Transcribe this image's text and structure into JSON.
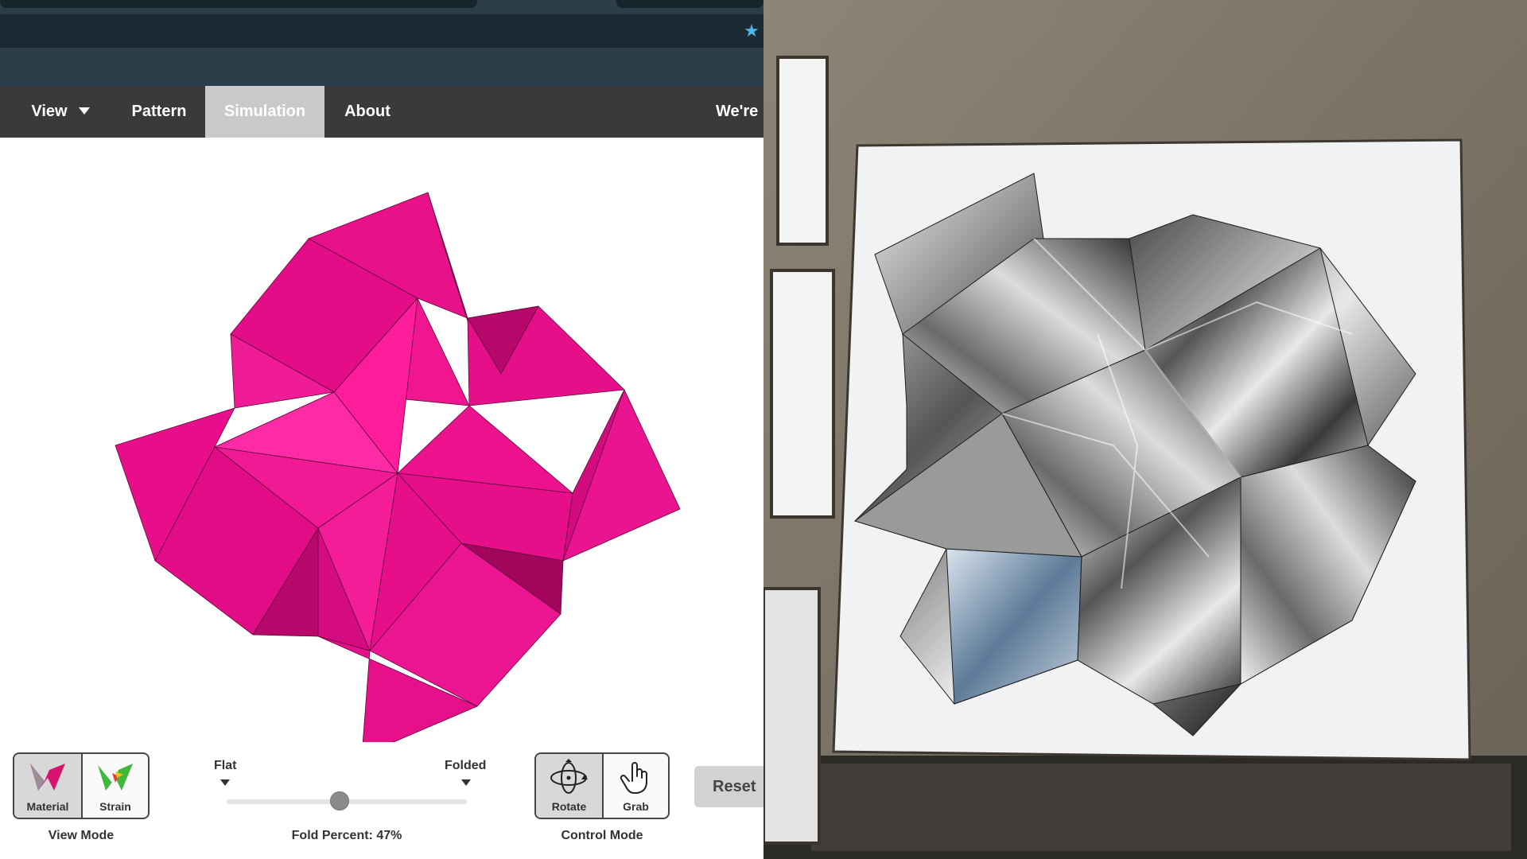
{
  "menu": {
    "view_label": "View",
    "pattern_label": "Pattern",
    "simulation_label": "Simulation",
    "about_label": "About",
    "right_text": "We're"
  },
  "view_mode": {
    "label": "View Mode",
    "material_label": "Material",
    "strain_label": "Strain",
    "selected": "Material"
  },
  "fold": {
    "flat_label": "Flat",
    "folded_label": "Folded",
    "percent_text": "Fold Percent: 47%",
    "percent": 47
  },
  "control_mode": {
    "label": "Control Mode",
    "rotate_label": "Rotate",
    "grab_label": "Grab",
    "selected": "Rotate"
  },
  "reset_label": "Reset",
  "colors": {
    "model_pink": "#ec0b8c",
    "menu_bg": "#3a3a3a",
    "menu_active_bg": "#c9c9c9",
    "chrome_bg": "#2b3e4a",
    "star": "#4fb6e8"
  },
  "icons": [
    "bookmark-star-icon",
    "chevron-down-icon",
    "material-icon",
    "strain-icon",
    "rotate-icon",
    "grab-hand-icon"
  ]
}
